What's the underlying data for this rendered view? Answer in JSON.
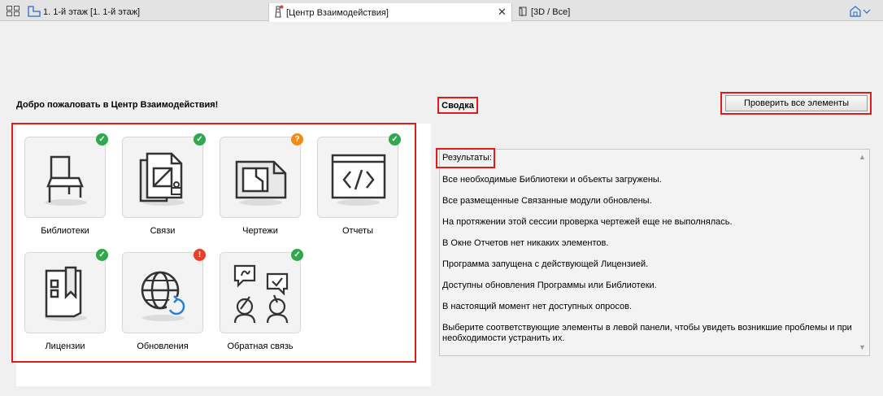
{
  "tabs": [
    {
      "label": "1. 1-й этаж [1. 1-й этаж]",
      "icon": "floor-plan-icon",
      "active": false
    },
    {
      "label": "[Центр Взаимодействия]",
      "icon": "lighthouse-icon",
      "active": true
    },
    {
      "label": "[3D / Все]",
      "icon": "cube-3d-icon",
      "active": false
    }
  ],
  "left": {
    "title": "Добро пожаловать в Центр Взаимодействия!",
    "tiles": [
      {
        "label": "Библиотеки",
        "icon": "chair-icon",
        "status": "ok"
      },
      {
        "label": "Связи",
        "icon": "linked-files-icon",
        "status": "ok"
      },
      {
        "label": "Чертежи",
        "icon": "drawings-icon",
        "status": "warning"
      },
      {
        "label": "Отчеты",
        "icon": "code-report-icon",
        "status": "ok"
      },
      {
        "label": "Лицензии",
        "icon": "license-icon",
        "status": "ok"
      },
      {
        "label": "Обновления",
        "icon": "globe-update-icon",
        "status": "error"
      },
      {
        "label": "Обратная связь",
        "icon": "feedback-icon",
        "status": "ok"
      }
    ]
  },
  "right": {
    "summary_title": "Сводка",
    "check_button": "Проверить все элементы",
    "results_header": "Результаты:",
    "results": [
      "Все необходимые Библиотеки и объекты загружены.",
      "Все размещенные Связанные модули обновлены.",
      "На протяжении этой сессии проверка чертежей еще не выполнялась.",
      "В Окне Отчетов нет никаких элементов.",
      "Программа запущена с действующей Лицензией.",
      "Доступны обновления Программы или Библиотеки.",
      "В настоящий момент нет доступных опросов.",
      "Выберите соответствующие элементы в левой панели, чтобы увидеть возникшие проблемы и при необходимости устранить их."
    ]
  },
  "colors": {
    "highlight": "#e01b1b",
    "ok": "#2fa84f",
    "warning": "#f08c1e",
    "error": "#e8402c"
  }
}
